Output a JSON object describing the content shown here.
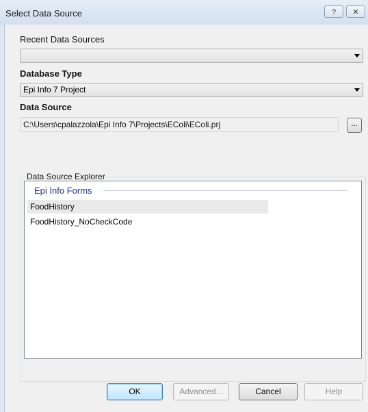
{
  "window": {
    "title": "Select Data Source",
    "help_glyph": "?",
    "close_glyph": "✕"
  },
  "recent": {
    "label": "Recent Data Sources",
    "value": ""
  },
  "database_type": {
    "label": "Database Type",
    "value": "Epi Info 7 Project"
  },
  "data_source": {
    "label": "Data Source",
    "value": "C:\\Users\\cpalazzola\\Epi Info 7\\Projects\\EColi\\EColi.prj",
    "browse_label": "..."
  },
  "explorer": {
    "group_label": "Data Source Explorer",
    "forms_header": "Epi Info Forms",
    "items": [
      {
        "label": "FoodHistory"
      },
      {
        "label": "FoodHistory_NoCheckCode"
      }
    ]
  },
  "buttons": {
    "ok": "OK",
    "advanced": "Advanced...",
    "cancel": "Cancel",
    "help": "Help"
  }
}
